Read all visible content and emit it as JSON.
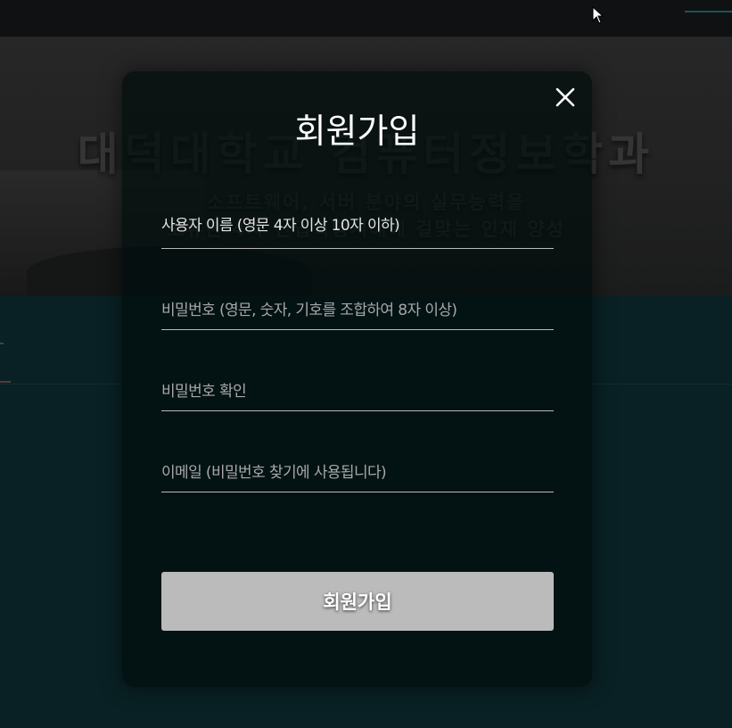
{
  "background": {
    "hero_title": "대덕대학교 컴퓨터정보학과",
    "hero_subtitle_line1": "소프트웨어, 서버 분야의 실무능력을",
    "hero_subtitle_line2": "보유한 4차 산업혁명시대에 걸맞는 인재 양성"
  },
  "modal": {
    "title": "회원가입",
    "close_icon": "close-icon",
    "fields": [
      {
        "label": "사용자 이름 (영문 4자 이상 10자 이하)",
        "value": ""
      },
      {
        "placeholder": "비밀번호 (영문, 숫자, 기호를 조합하여 8자 이상)",
        "value": ""
      },
      {
        "placeholder": "비밀번호 확인",
        "value": ""
      },
      {
        "placeholder": "이메일 (비밀번호 찾기에 사용됩니다)",
        "value": ""
      }
    ],
    "submit_label": "회원가입"
  },
  "colors": {
    "hero_bg": "#262626",
    "page_bg": "#0a2428",
    "modal_bg": "#020c0d",
    "button_bg": "#bbbbbb",
    "nav_accent": "#1f5d62"
  }
}
